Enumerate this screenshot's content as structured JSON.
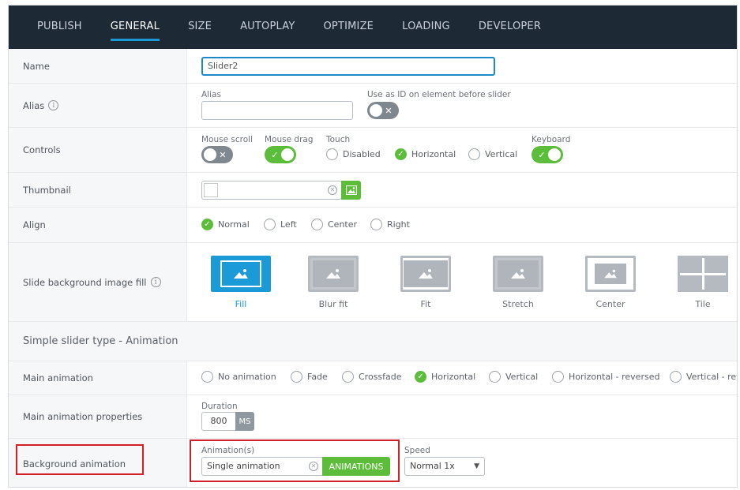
{
  "tabs": [
    {
      "label": "PUBLISH",
      "active": false
    },
    {
      "label": "GENERAL",
      "active": true
    },
    {
      "label": "SIZE",
      "active": false
    },
    {
      "label": "AUTOPLAY",
      "active": false
    },
    {
      "label": "OPTIMIZE",
      "active": false
    },
    {
      "label": "LOADING",
      "active": false
    },
    {
      "label": "DEVELOPER",
      "active": false
    }
  ],
  "name": {
    "label": "Name",
    "value": "Slider2"
  },
  "alias": {
    "label": "Alias",
    "field_label": "Alias",
    "value": "",
    "use_id_label": "Use as ID on element before slider",
    "use_id_on": false
  },
  "controls": {
    "label": "Controls",
    "mouse_scroll_label": "Mouse scroll",
    "mouse_scroll_on": false,
    "mouse_drag_label": "Mouse drag",
    "mouse_drag_on": true,
    "touch_label": "Touch",
    "touch_options": [
      "Disabled",
      "Horizontal",
      "Vertical"
    ],
    "touch_selected": "Horizontal",
    "keyboard_label": "Keyboard",
    "keyboard_on": true
  },
  "thumbnail": {
    "label": "Thumbnail",
    "value": ""
  },
  "align": {
    "label": "Align",
    "options": [
      "Normal",
      "Left",
      "Center",
      "Right"
    ],
    "selected": "Normal"
  },
  "bg_fill": {
    "label": "Slide background image fill",
    "options": [
      "Fill",
      "Blur fit",
      "Fit",
      "Stretch",
      "Center",
      "Tile"
    ],
    "selected": "Fill"
  },
  "section_title": "Simple slider type - Animation",
  "main_animation": {
    "label": "Main animation",
    "options": [
      "No animation",
      "Fade",
      "Crossfade",
      "Horizontal",
      "Vertical",
      "Horizontal - reversed",
      "Vertical - rev"
    ],
    "selected": "Horizontal"
  },
  "main_props": {
    "label": "Main animation properties",
    "duration_label": "Duration",
    "duration_value": "800",
    "duration_unit": "MS"
  },
  "bg_animation": {
    "label": "Background animation",
    "animations_label": "Animation(s)",
    "animations_value": "Single animation",
    "animations_button": "ANIMATIONS",
    "speed_label": "Speed",
    "speed_value": "Normal 1x"
  },
  "colors": {
    "nav_bg": "#1d2935",
    "accent_blue": "#1a9bd8",
    "accent_green": "#5cbd3a",
    "highlight_red": "#d51f26"
  }
}
